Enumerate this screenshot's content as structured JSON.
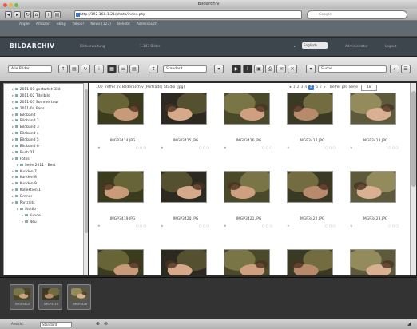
{
  "window": {
    "title": "Bildarchiv"
  },
  "toolbar": {
    "url": "http://192.168.1.21/photo/index.php",
    "search_placeholder": "Google"
  },
  "bookmarks": {
    "items": [
      "Apple",
      "Amazon",
      "eBay",
      "Yahoo!",
      "News (127)",
      "Beliebt",
      "Adressbuch"
    ]
  },
  "header": {
    "logo": "BILDARCHIV",
    "tagline": "Bildverwaltung",
    "info": "1.103 Bilder",
    "select_value": "Englisch",
    "user": "Administrator",
    "logout": "Logout"
  },
  "controls": {
    "folder_select": "Alle Bilder",
    "view_select": "Standard",
    "search_select": "Suche"
  },
  "sidebar": {
    "items": [
      {
        "label": "2011-01 gestartet Bild",
        "indent": 1
      },
      {
        "label": "2011-02 Titelbild",
        "indent": 1
      },
      {
        "label": "2011-03 Sommertour",
        "indent": 1
      },
      {
        "label": "2011-04 Paris",
        "indent": 1
      },
      {
        "label": "Bildband",
        "indent": 1
      },
      {
        "label": "Bildband 2",
        "indent": 1
      },
      {
        "label": "Bildband 3",
        "indent": 1
      },
      {
        "label": "Bildband 4",
        "indent": 1
      },
      {
        "label": "Bildband 5",
        "indent": 1
      },
      {
        "label": "Bildband 6",
        "indent": 1
      },
      {
        "label": "Buch 01",
        "indent": 1
      },
      {
        "label": "Fotos",
        "indent": 1
      },
      {
        "label": "Serie 2011 - Best",
        "indent": 2
      },
      {
        "label": "Kunden 7",
        "indent": 1
      },
      {
        "label": "Kunden 8",
        "indent": 1
      },
      {
        "label": "Kunden 9",
        "indent": 1
      },
      {
        "label": "Kollektion 1",
        "indent": 1
      },
      {
        "label": "Ordner",
        "indent": 1
      },
      {
        "label": "Portraits",
        "indent": 1
      },
      {
        "label": "Studio",
        "indent": 2
      },
      {
        "label": "Kunde",
        "indent": 3
      },
      {
        "label": "Neu",
        "indent": 3
      }
    ]
  },
  "pagination": {
    "result_text": "100 Treffer in: Bilderarchiv (Portraits) Studio (Jpg)",
    "pages": [
      "1",
      "2",
      "3",
      "4",
      "5",
      "6",
      "7"
    ],
    "current": "5",
    "per_page_label": "Treffer pro Seite",
    "per_page_value": "18"
  },
  "grid": {
    "rows": [
      {
        "names": [
          "IMGP3414.JPG",
          "IMGP3415.JPG",
          "IMGP3416.JPG",
          "IMGP3417.JPG",
          "IMGP3418.JPG"
        ]
      },
      {
        "names": [
          "IMGP3419.JPG",
          "IMGP3420.JPG",
          "IMGP3421.JPG",
          "IMGP3422.JPG",
          "IMGP3423.JPG"
        ]
      },
      {
        "names": [
          "",
          "",
          "",
          "",
          ""
        ]
      }
    ],
    "meta_left": "★",
    "meta_right": "○ ○ ○"
  },
  "strip": {
    "items": [
      "IMGP3424",
      "IMGP3425",
      "IMGP3426"
    ]
  },
  "status": {
    "label": "Ansicht:",
    "select": "Standard"
  },
  "colors": {
    "accent": "#3a7bd5",
    "header_bg": "#3d464c",
    "strip_bg": "#333333"
  }
}
